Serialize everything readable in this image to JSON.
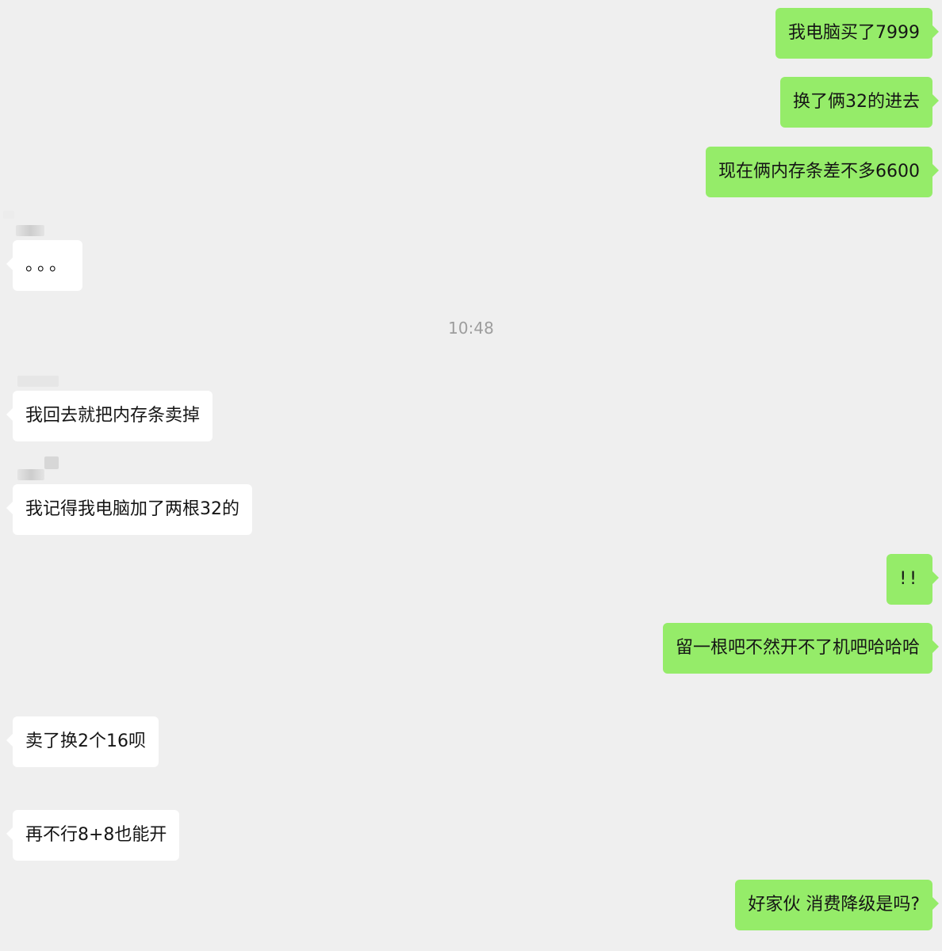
{
  "chat": {
    "timestamp": "10:48",
    "messages": [
      {
        "id": 1,
        "side": "out",
        "text": "我电脑买了7999"
      },
      {
        "id": 2,
        "side": "out",
        "text": "换了俩32的进去"
      },
      {
        "id": 3,
        "side": "out",
        "text": "现在俩内存条差不多6600"
      },
      {
        "id": 4,
        "side": "in",
        "text": "。。。"
      },
      {
        "id": 5,
        "side": "in",
        "text": "我回去就把内存条卖掉"
      },
      {
        "id": 6,
        "side": "in",
        "text": "我记得我电脑加了两根32的"
      },
      {
        "id": 7,
        "side": "out",
        "text": "!!"
      },
      {
        "id": 8,
        "side": "out",
        "text": "留一根吧不然开不了机吧哈哈哈"
      },
      {
        "id": 9,
        "side": "in",
        "text": "卖了换2个16呗"
      },
      {
        "id": 10,
        "side": "in",
        "text": "再不行8+8也能开"
      },
      {
        "id": 11,
        "side": "out",
        "text": "好家伙 消费降级是吗?"
      }
    ]
  },
  "colors": {
    "background": "#efefef",
    "outgoing_bubble": "#95ec69",
    "incoming_bubble": "#ffffff",
    "timestamp_text": "#9d9d9d"
  }
}
